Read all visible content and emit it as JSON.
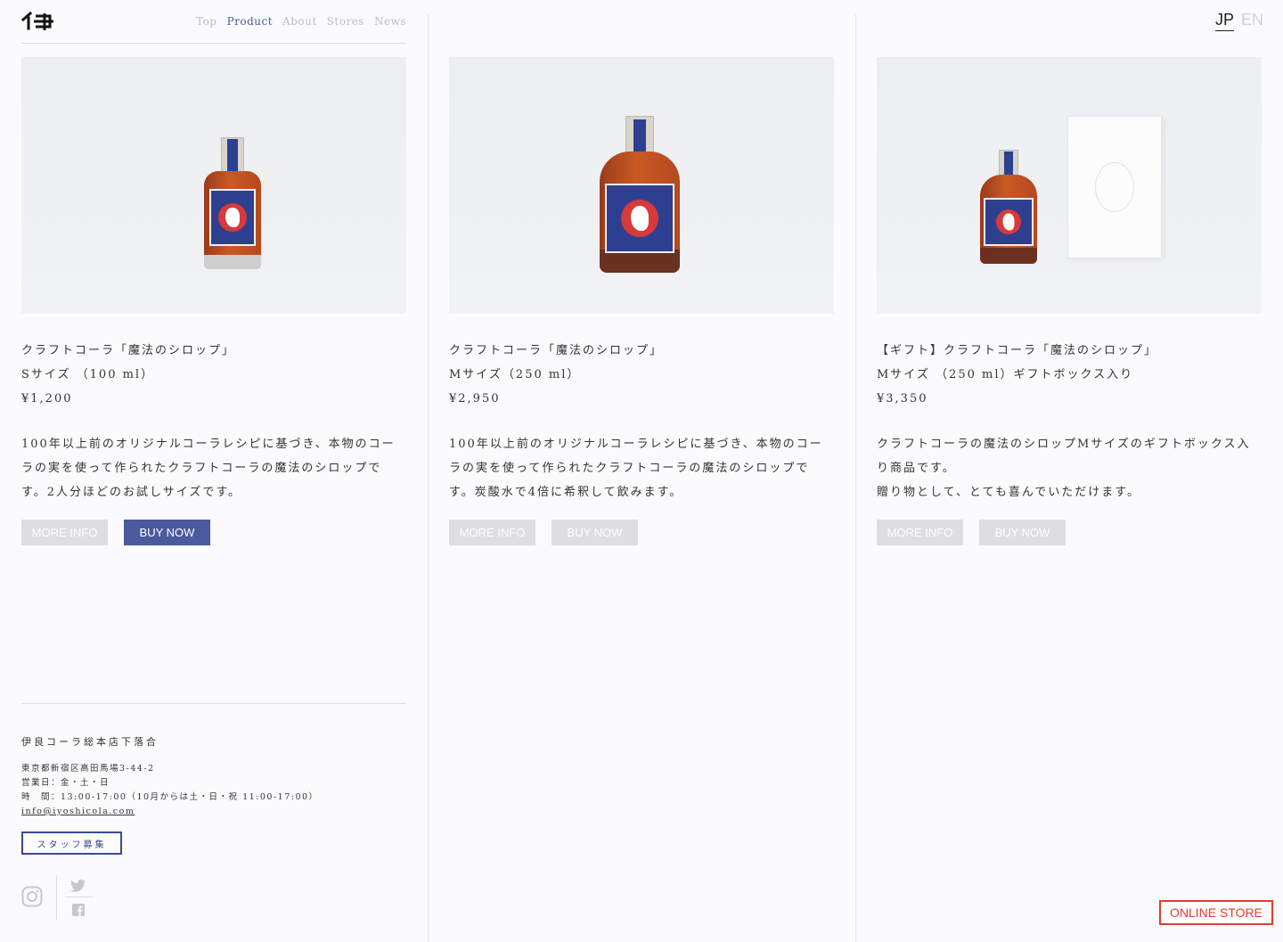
{
  "header": {
    "logo_text": "イ尹",
    "nav": [
      {
        "label": "Top",
        "active": false
      },
      {
        "label": "Product",
        "active": true
      },
      {
        "label": "About",
        "active": false
      },
      {
        "label": "Stores",
        "active": false
      },
      {
        "label": "News",
        "active": false
      }
    ],
    "lang": {
      "jp": "JP",
      "en": "EN"
    }
  },
  "products": [
    {
      "name": "クラフトコーラ「魔法のシロップ」",
      "size": "Sサイズ （100 ml）",
      "price": "¥1,200",
      "description": "100年以上前のオリジナルコーラレシピに基づき、本物のコーラの実を使って作られたクラフトコーラの魔法のシロップです。2人分ほどのお試しサイズです。",
      "more_info": "MORE INFO",
      "buy_now": "BUY NOW",
      "buy_enabled": true
    },
    {
      "name": "クラフトコーラ「魔法のシロップ」",
      "size": "Mサイズ（250 ml）",
      "price": "¥2,950",
      "description": "100年以上前のオリジナルコーラレシピに基づき、本物のコーラの実を使って作られたクラフトコーラの魔法のシロップです。炭酸水で4倍に希釈して飲みます。",
      "more_info": "MORE INFO",
      "buy_now": "BUY NOW",
      "buy_enabled": false
    },
    {
      "name": "【ギフト】クラフトコーラ「魔法のシロップ」",
      "size": "Mサイズ （250 ml）ギフトボックス入り",
      "price": "¥3,350",
      "description": "クラフトコーラの魔法のシロップMサイズのギフトボックス入り商品です。\n贈り物として、とても喜んでいただけます。",
      "more_info": "MORE INFO",
      "buy_now": "BUY NOW",
      "buy_enabled": false
    }
  ],
  "footer": {
    "shop_name": "伊良コーラ総本店下落合",
    "address": "東京都新宿区高田馬場3-44-2",
    "open_days": "営業日：金・土・日",
    "hours": "時　間：13:00-17:00（10月からは土・日・祝 11:00-17:00）",
    "email": "info@iyoshicola.com",
    "staff_button": "スタッフ募集"
  },
  "online_store": "ONLINE STORE",
  "colors": {
    "accent": "#4a5a9e",
    "online_store": "#e53b2c",
    "disabled_button": "#dedee2"
  }
}
